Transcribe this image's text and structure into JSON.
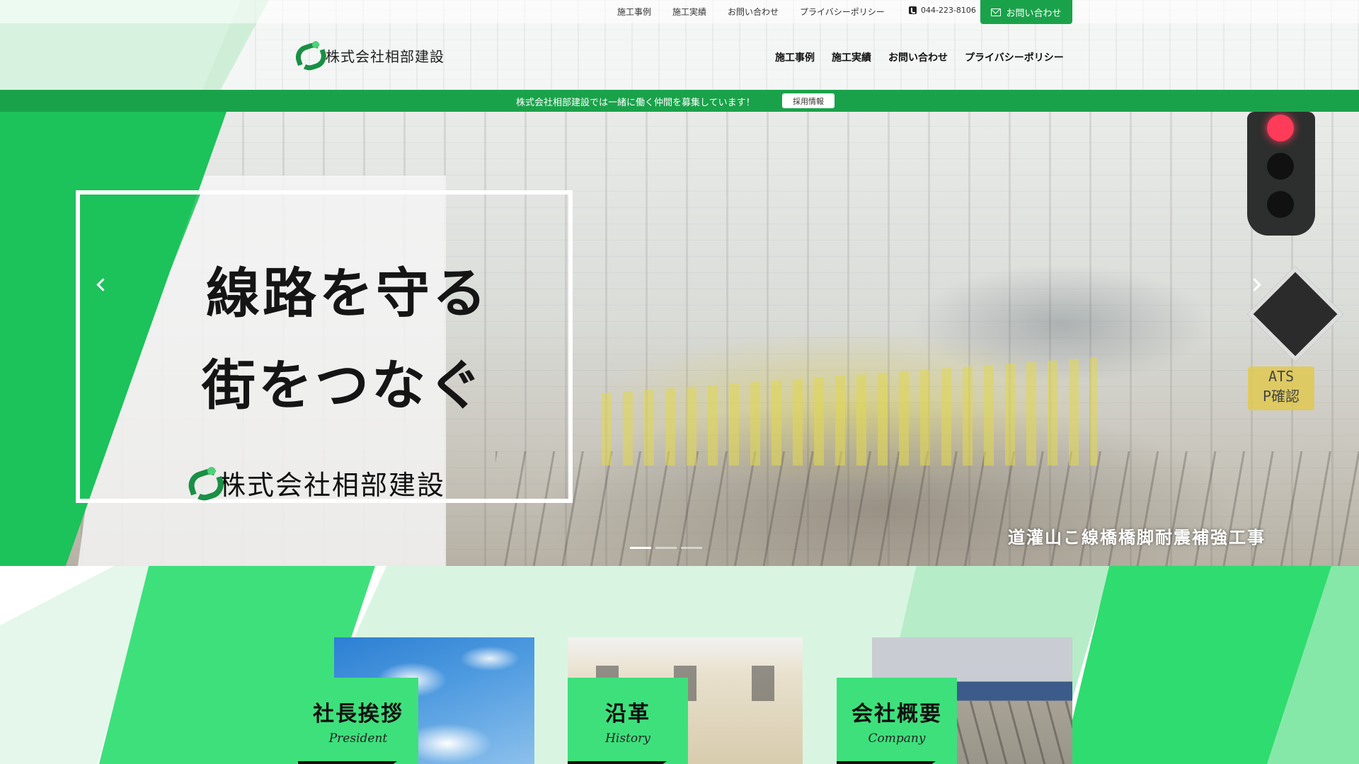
{
  "topbar": {
    "links": [
      "施工事例",
      "施工実績",
      "お問い合わせ",
      "プライバシーポリシー"
    ],
    "phone": "044-223-8106",
    "contact_button": "お問い合わせ"
  },
  "logo": {
    "text": "株式会社相部建設"
  },
  "nav": {
    "items": [
      "施工事例",
      "施工実績",
      "お問い合わせ",
      "プライバシーポリシー"
    ]
  },
  "recruit": {
    "text": "株式会社相部建設では一緒に働く仲間を募集しています！",
    "button": "採用情報"
  },
  "hero": {
    "slogan_line1": "線路を守る",
    "slogan_line2": "街をつなぐ",
    "slogan_logo": "株式会社相部建設",
    "caption": "道灌山こ線橋橋脚耐震補強工事",
    "slide_count": 3,
    "active_slide": 1,
    "signal_text": "ATS\nP確認"
  },
  "cards": [
    {
      "jp": "社長挨拶",
      "en": "President"
    },
    {
      "jp": "沿革",
      "en": "History"
    },
    {
      "jp": "会社概要",
      "en": "Company"
    }
  ],
  "colors": {
    "brand_green": "#1aa24a",
    "accent_green": "#3ee07c",
    "light_green": "#d9f5e2"
  }
}
